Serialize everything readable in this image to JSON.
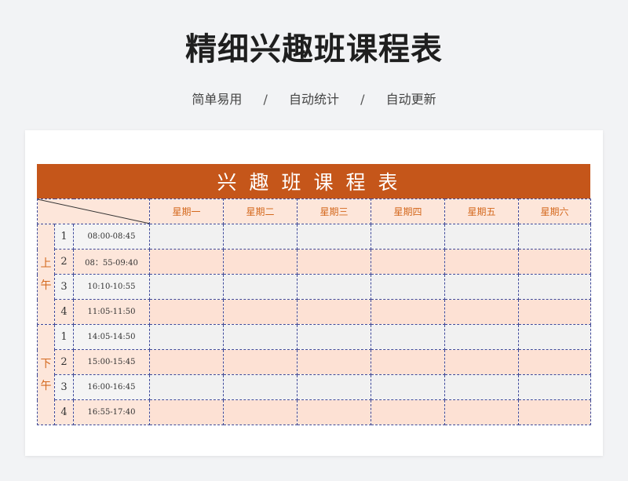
{
  "header": {
    "title": "精细兴趣班课程表",
    "tags": [
      "简单易用",
      "自动统计",
      "自动更新"
    ],
    "separator": "/"
  },
  "banner": {
    "title": "兴趣班课程表"
  },
  "table": {
    "days": [
      "星期一",
      "星期二",
      "星期三",
      "星期四",
      "星期五",
      "星期六"
    ],
    "periods": [
      {
        "label_top": "上",
        "label_bottom": "午",
        "slots": [
          {
            "num": "1",
            "time": "08:00-08:45"
          },
          {
            "num": "2",
            "time": "08：55-09:40"
          },
          {
            "num": "3",
            "time": "10:10-10:55"
          },
          {
            "num": "4",
            "time": "11:05-11:50"
          }
        ]
      },
      {
        "label_top": "下",
        "label_bottom": "午",
        "slots": [
          {
            "num": "1",
            "time": "14:05-14:50"
          },
          {
            "num": "2",
            "time": "15:00-15:45"
          },
          {
            "num": "3",
            "time": "16:00-16:45"
          },
          {
            "num": "4",
            "time": "16:55-17:40"
          }
        ]
      }
    ]
  },
  "colors": {
    "banner": "#c5561a",
    "accent_text": "#d4691e",
    "row_pink": "#fde1d4",
    "row_gray": "#f1f1f1",
    "grid_line": "#3f4a9a"
  }
}
